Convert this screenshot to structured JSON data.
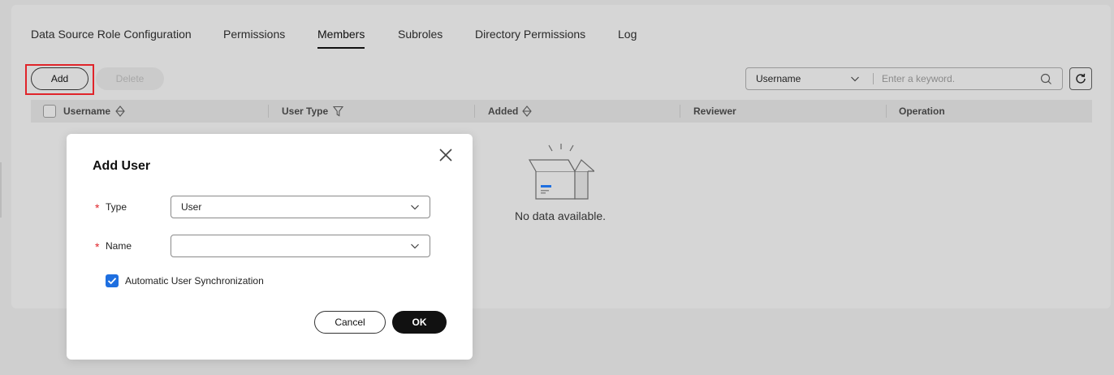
{
  "tabs": [
    {
      "label": "Data Source Role Configuration"
    },
    {
      "label": "Permissions"
    },
    {
      "label": "Members"
    },
    {
      "label": "Subroles"
    },
    {
      "label": "Directory Permissions"
    },
    {
      "label": "Log"
    }
  ],
  "active_tab": "Members",
  "toolbar": {
    "add_label": "Add",
    "delete_label": "Delete",
    "filter_field": "Username",
    "search_placeholder": "Enter a keyword."
  },
  "table": {
    "columns": [
      "Username",
      "User Type",
      "Added",
      "Reviewer",
      "Operation"
    ],
    "rows": [],
    "empty_text": "No data available."
  },
  "dialog": {
    "title": "Add User",
    "type_label": "Type",
    "type_value": "User",
    "name_label": "Name",
    "name_value": "",
    "sync_label": "Automatic User Synchronization",
    "sync_checked": true,
    "cancel_label": "Cancel",
    "ok_label": "OK"
  },
  "colors": {
    "accent": "#1e6fe0",
    "required": "#e0242a",
    "highlight": "#e0242a",
    "primary_button": "#111111"
  },
  "icons": {
    "sort": "sort-icon",
    "filter": "filter-icon",
    "search": "search-icon",
    "refresh": "refresh-icon",
    "close": "close-icon",
    "chevron": "chevron-down-icon",
    "empty": "empty-box-icon"
  }
}
